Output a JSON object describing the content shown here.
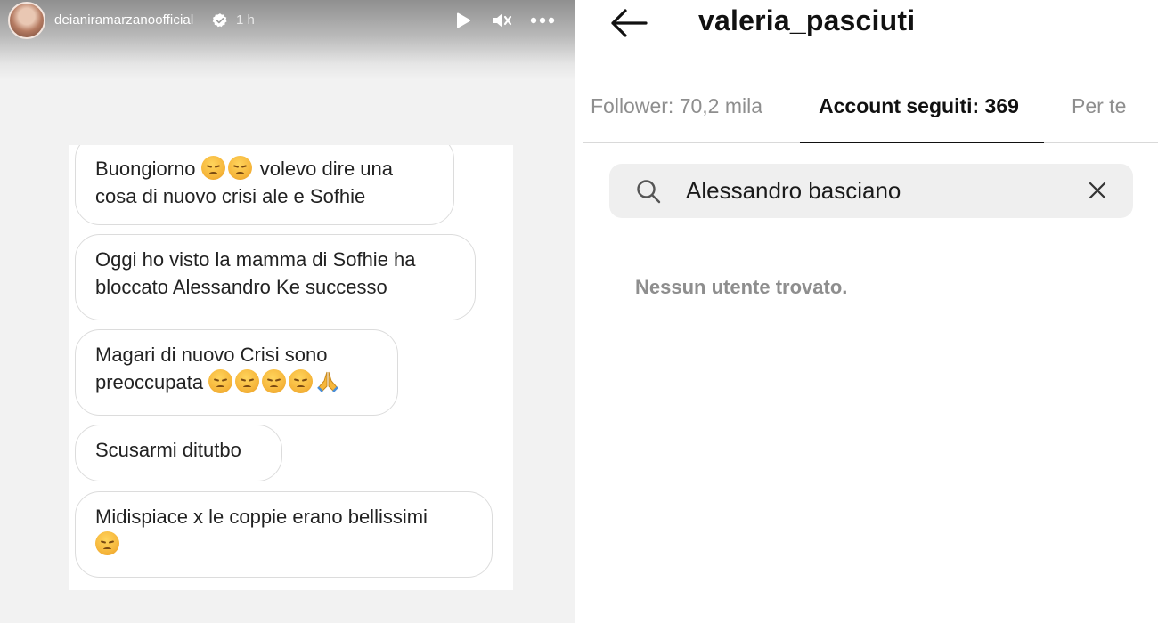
{
  "story": {
    "username": "deianiramarzanoofficial",
    "time": "1 h",
    "messages": [
      {
        "text": "Buongiorno",
        "emojis": [
          "disappointed-face",
          "disappointed-face"
        ],
        "after": "volevo dire una cosa di nuovo crisi ale e Sofhie"
      },
      {
        "text": "Oggi ho visto la mamma di Sofhie ha bloccato Alessandro Ke successo"
      },
      {
        "text": "Magari di nuovo Crisi sono preoccupata",
        "emojis": [
          "pensive-face",
          "pensive-face",
          "pensive-face",
          "disappointed-face",
          "folded-hands"
        ]
      },
      {
        "text": "Scusarmi ditutbo"
      },
      {
        "text": "Midispiace x le coppie erano bellissimi",
        "emojis": [
          "disappointed-face"
        ]
      }
    ],
    "icons": {
      "play": "play-icon",
      "mute": "mute-icon",
      "more": "more-icon",
      "verified": "verified-badge-icon"
    }
  },
  "profile": {
    "title": "valeria_pasciuti",
    "tabs": [
      {
        "label": "Follower: 70,2 mila",
        "active": false
      },
      {
        "label": "Account seguiti: 369",
        "active": true
      },
      {
        "label": "Per te",
        "active": false
      }
    ],
    "search": {
      "value": "Alessandro basciano"
    },
    "empty_message": "Nessun utente trovato."
  },
  "colors": {
    "accent": "#111111",
    "muted": "#8e8e8e",
    "search_bg": "#efefef",
    "verified": "#3897f0"
  }
}
